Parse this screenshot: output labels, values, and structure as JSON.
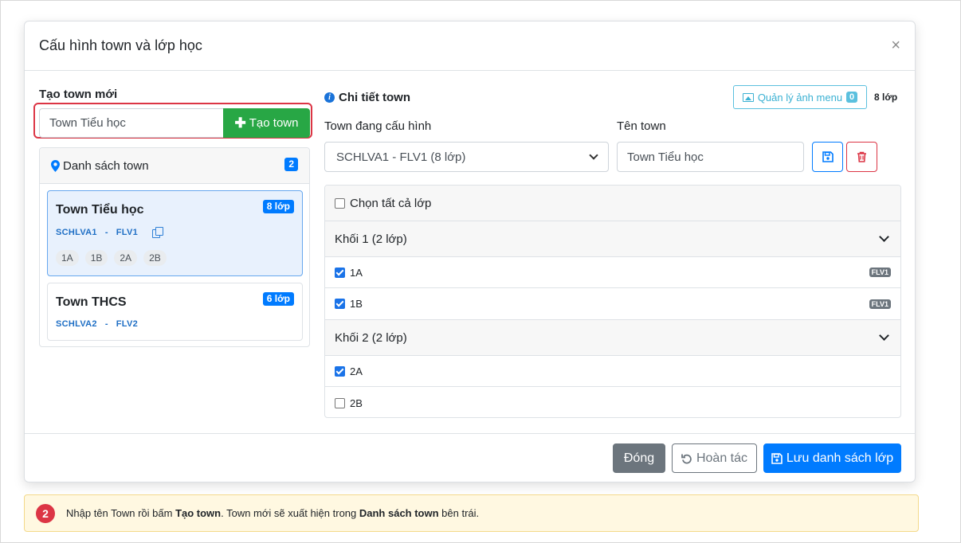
{
  "modal": {
    "title": "Cấu hình town và lớp học",
    "close_symbol": "×"
  },
  "create": {
    "label": "Tạo town mới",
    "input_value": "Town Tiểu học",
    "button_label": "Tạo town",
    "button_icon": "plus-icon"
  },
  "town_list": {
    "title": "Danh sách town",
    "title_icon": "map-marker-icon",
    "count": "2",
    "items": [
      {
        "name": "Town Tiểu học",
        "count_label": "8 lớp",
        "school_code": "SCHLVA1",
        "separator": "-",
        "level_code": "FLV1",
        "classes": [
          "1A",
          "1B",
          "2A",
          "2B"
        ],
        "active": true
      },
      {
        "name": "Town THCS",
        "count_label": "6 lớp",
        "school_code": "SCHLVA2",
        "separator": "-",
        "level_code": "FLV2",
        "active": false
      }
    ]
  },
  "detail": {
    "title": "Chi tiết town",
    "title_icon": "info-icon",
    "menu_image_button": "Quản lý ảnh menu",
    "menu_image_count": "0",
    "class_count_label": "8 lớp",
    "select_label": "Town đang cấu hình",
    "select_value": "SCHLVA1 - FLV1 (8 lớp)",
    "name_label": "Tên town",
    "name_value": "Town Tiểu học"
  },
  "classes": {
    "select_all_label": "Chọn tất cả lớp",
    "groups": [
      {
        "title": "Khối 1 (2 lớp)",
        "rows": [
          {
            "label": "1A",
            "checked": true,
            "badge": "FLV1"
          },
          {
            "label": "1B",
            "checked": true,
            "badge": "FLV1"
          }
        ]
      },
      {
        "title": "Khối 2 (2 lớp)",
        "rows": [
          {
            "label": "2A",
            "checked": true,
            "badge": ""
          },
          {
            "label": "2B",
            "checked": false,
            "badge": ""
          }
        ]
      }
    ]
  },
  "footer": {
    "close_label": "Đóng",
    "undo_label": "Hoàn tác",
    "save_label": "Lưu danh sách lớp"
  },
  "hint": {
    "step": "2",
    "part1": "Nhập tên Town rồi bấm ",
    "bold1": "Tạo town",
    "part2": ". Town mới sẽ xuất hiện trong ",
    "bold2": "Danh sách town",
    "part3": " bên trái."
  },
  "colors": {
    "primary": "#007bff",
    "success": "#28a745",
    "danger": "#dc3545",
    "secondary": "#6c757d",
    "info": "#5bc0de",
    "hint_background": "#fff8e1"
  }
}
